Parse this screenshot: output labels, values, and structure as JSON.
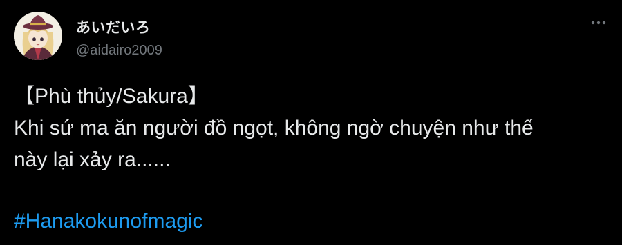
{
  "tweet": {
    "display_name": "あいだいろ",
    "handle": "@aidairo2009",
    "more_icon": "more-horizontal-icon",
    "text_lines": [
      "【Phù thủy/Sakura】",
      "Khi sứ ma ăn người đồ ngọt, không ngờ chuyện như thế",
      "này lại xảy ra......"
    ],
    "hashtag": "#Hanakokunofmagic"
  },
  "colors": {
    "background": "#000000",
    "primary_text": "#e7e9ea",
    "secondary_text": "#71767b",
    "link": "#1d9bf0"
  }
}
